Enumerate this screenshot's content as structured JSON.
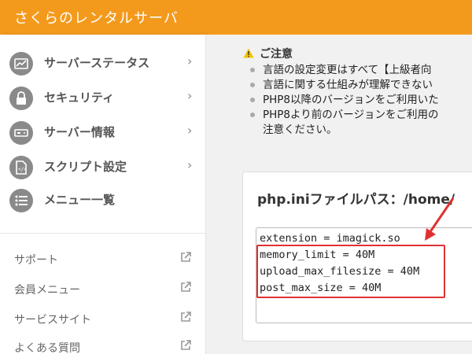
{
  "app": {
    "title": "さくらのレンタルサーバ"
  },
  "sidebar": {
    "items": [
      {
        "label": "サーバーステータス",
        "icon": "chart-icon"
      },
      {
        "label": "セキュリティ",
        "icon": "lock-icon"
      },
      {
        "label": "サーバー情報",
        "icon": "server-icon"
      },
      {
        "label": "スクリプト設定",
        "icon": "script-file-icon"
      },
      {
        "label": "メニュー一覧",
        "icon": "list-icon"
      }
    ],
    "links": [
      {
        "label": "サポート"
      },
      {
        "label": "会員メニュー"
      },
      {
        "label": "サービスサイト"
      },
      {
        "label": "よくある質問"
      }
    ]
  },
  "notice": {
    "title": "ご注意",
    "items": [
      "言語の設定変更はすべて【上級者向",
      "言語に関する仕組みが理解できない",
      "PHP8以降のバージョンをご利用いた",
      "PHP8より前のバージョンをご利用の",
      "注意ください。"
    ]
  },
  "phpini": {
    "title": "php.iniファイルパス：/home/",
    "lines": [
      "extension = imagick.so",
      "memory_limit = 40M",
      "upload_max_filesize = 40M",
      "post_max_size = 40M"
    ]
  },
  "colors": {
    "header": "#f39a1d",
    "highlight": "#e03131"
  }
}
